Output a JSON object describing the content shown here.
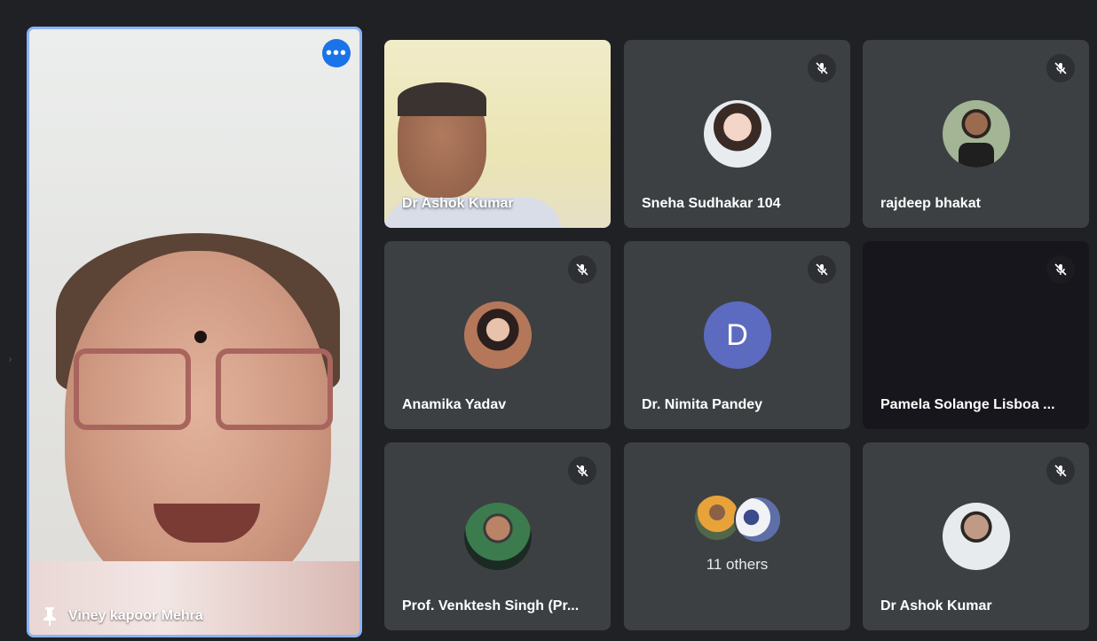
{
  "pinned": {
    "name": "Viney kapoor Mehra"
  },
  "tiles": [
    {
      "name": "Dr Ashok Kumar",
      "type": "video"
    },
    {
      "name": "Sneha Sudhakar 104",
      "type": "avatar",
      "muted": true
    },
    {
      "name": "rajdeep bhakat",
      "type": "avatar",
      "muted": true
    },
    {
      "name": "Anamika Yadav",
      "type": "avatar",
      "muted": true
    },
    {
      "name": "Dr. Nimita Pandey",
      "type": "letter",
      "letter": "D",
      "muted": true
    },
    {
      "name": "Pamela Solange Lisboa ...",
      "type": "dark",
      "muted": true
    },
    {
      "name": "Prof. Venktesh Singh (Pr...",
      "type": "avatar",
      "muted": true
    },
    {
      "name": "11 others",
      "type": "others"
    },
    {
      "name": "Dr Ashok Kumar",
      "type": "avatar",
      "muted": true
    }
  ],
  "colors": {
    "background": "#202124",
    "tile": "#3c4043",
    "active_border": "#8ab4f8",
    "more_button": "#1a73e8",
    "letter_avatar": "#5c6bc0"
  }
}
